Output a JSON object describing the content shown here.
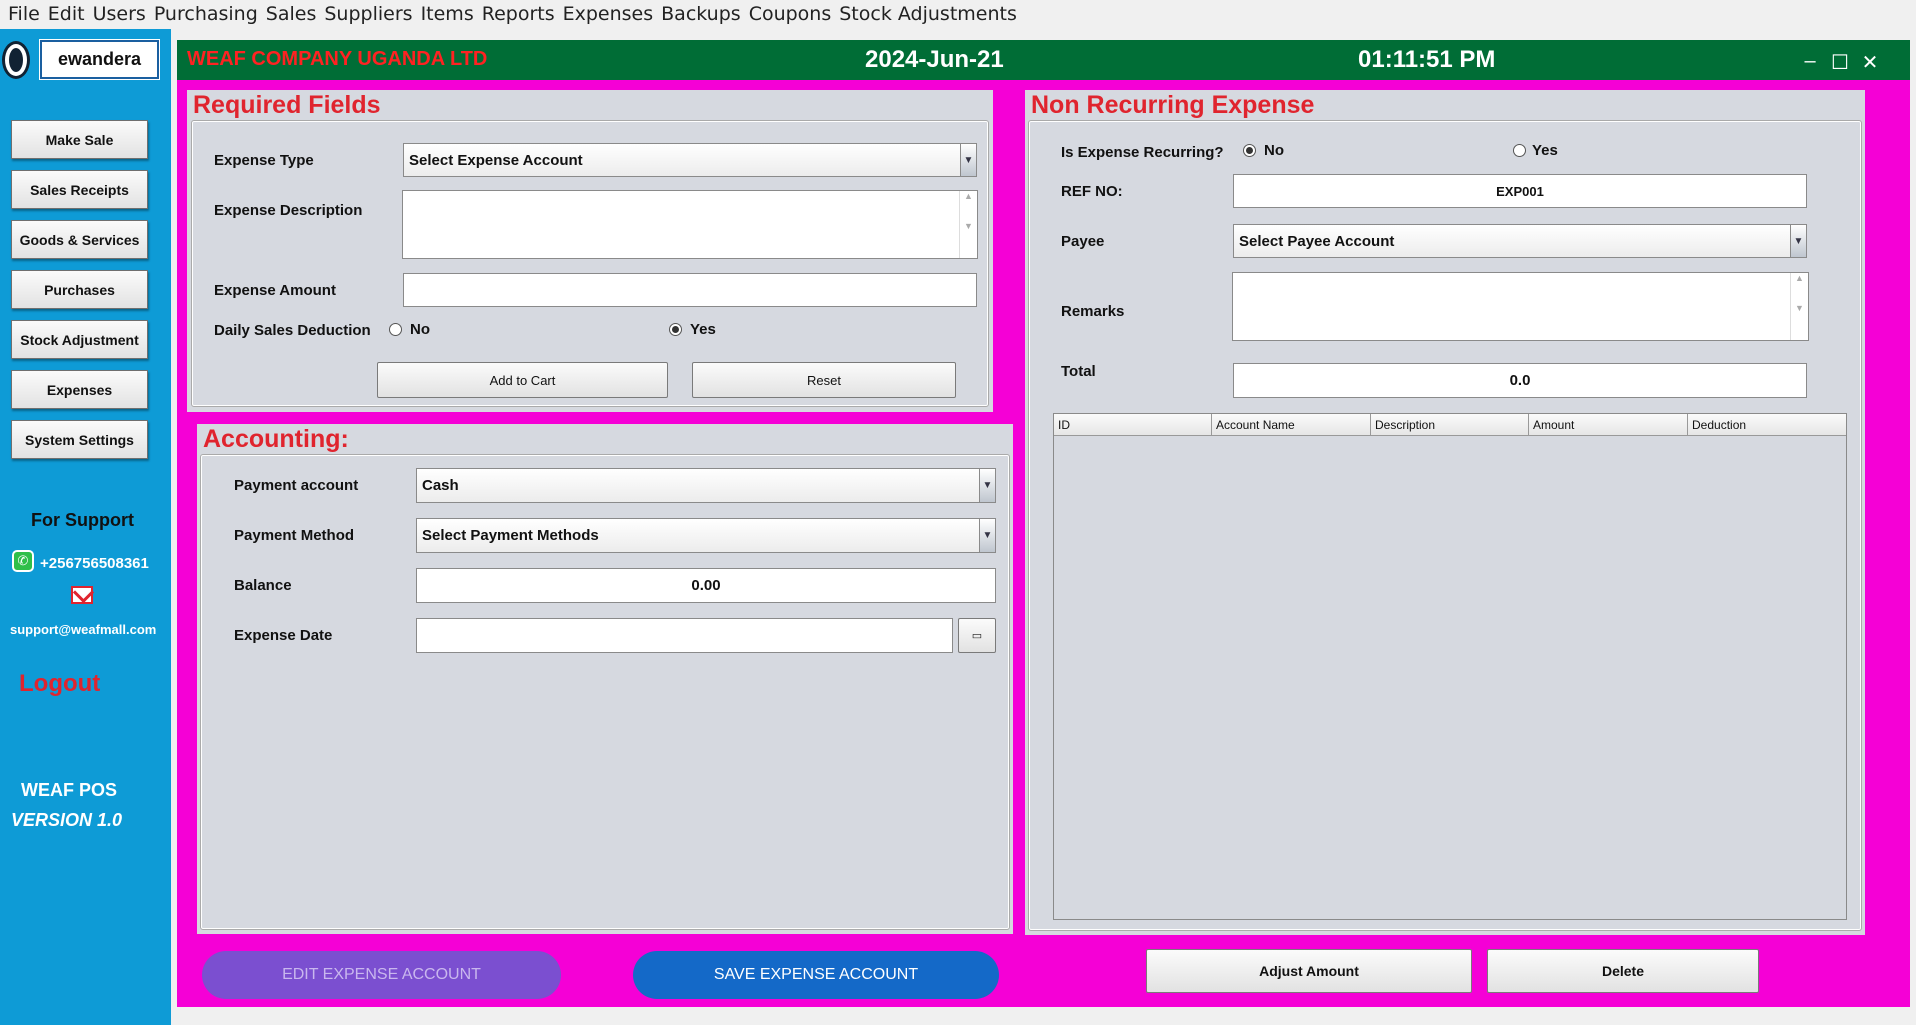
{
  "menu": [
    "File",
    "Edit",
    "Users",
    "Purchasing",
    "Sales",
    "Suppliers",
    "Items",
    "Reports",
    "Expenses",
    "Backups",
    "Coupons",
    "Stock Adjustments"
  ],
  "sidebar": {
    "username": "ewandera",
    "buttons": [
      "Make  Sale",
      "Sales Receipts",
      "Goods & Services",
      "Purchases",
      "Stock Adjustment",
      "Expenses",
      "System Settings"
    ],
    "support_title": "For Support",
    "phone": "+256756508361",
    "email": "support@weafmall.com",
    "logout": "Logout",
    "app_name": "WEAF POS",
    "version": "VERSION 1.0"
  },
  "header": {
    "company": "WEAF COMPANY UGANDA LTD",
    "date": "2024-Jun-21",
    "time": "01:11:51 PM"
  },
  "required": {
    "title": "Required Fields",
    "expense_type_label": "Expense Type",
    "expense_type_value": "Select Expense Account",
    "description_label": "Expense Description",
    "description_value": "",
    "amount_label": "Expense Amount",
    "amount_value": "",
    "deduction_label": "Daily Sales Deduction",
    "deduction_no": "No",
    "deduction_yes": "Yes",
    "deduction_selected": "Yes",
    "add_to_cart": "Add to Cart",
    "reset": "Reset"
  },
  "accounting": {
    "title": "Accounting:",
    "payment_account_label": "Payment account",
    "payment_account_value": "Cash",
    "payment_method_label": "Payment Method",
    "payment_method_value": "Select Payment Methods",
    "balance_label": "Balance",
    "balance_value": "0.00",
    "date_label": "Expense Date",
    "date_value": ""
  },
  "nonrecurring": {
    "title": "Non Recurring Expense",
    "recurring_label": "Is Expense Recurring?",
    "recurring_no": "No",
    "recurring_yes": "Yes",
    "recurring_selected": "No",
    "ref_label": "REF NO:",
    "ref_value": "EXP001",
    "payee_label": "Payee",
    "payee_value": "Select Payee Account",
    "remarks_label": "Remarks",
    "remarks_value": "",
    "total_label": "Total",
    "total_value": "0.0",
    "columns": [
      "ID",
      "Account Name",
      "Description",
      "Amount",
      "Deduction"
    ],
    "rows": []
  },
  "actions": {
    "edit": "EDIT EXPENSE ACCOUNT",
    "save": "SAVE EXPENSE ACCOUNT",
    "adjust": "Adjust Amount",
    "delete": "Delete"
  },
  "colors": {
    "sidebar": "#0e9bd6",
    "header": "#006d36",
    "background": "#f500d6",
    "title_red": "#e0242e",
    "edit_button": "#7b4fd0",
    "save_button": "#1469c8"
  },
  "icons": [
    "whatsapp-icon",
    "mail-icon",
    "calendar-icon",
    "minimize-icon",
    "maximize-icon",
    "close-icon"
  ]
}
